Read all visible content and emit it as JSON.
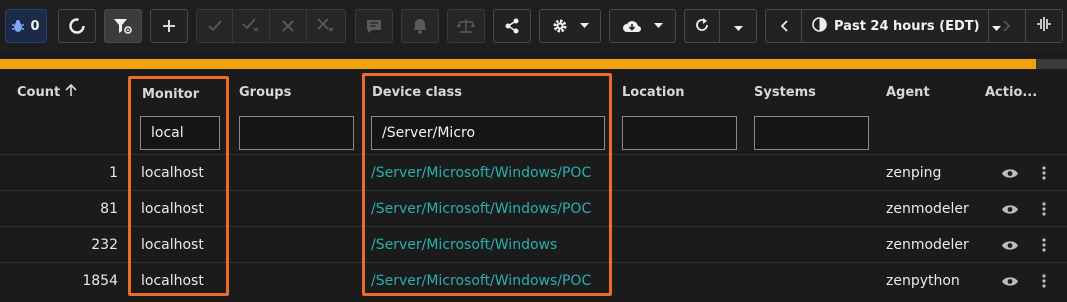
{
  "toolbar": {
    "bug_count": "0",
    "time_range": "Past 24 hours (EDT)"
  },
  "table": {
    "columns": {
      "count": "Count",
      "monitor": "Monitor",
      "groups": "Groups",
      "device_class": "Device class",
      "location": "Location",
      "systems": "Systems",
      "agent": "Agent",
      "actions": "Actio..."
    },
    "filters": {
      "monitor": "local",
      "groups": "",
      "device_class": "/Server/Micro",
      "location": "",
      "systems": ""
    },
    "rows": [
      {
        "count": "1",
        "monitor": "localhost",
        "groups": "",
        "device_class": "/Server/Microsoft/Windows/POC",
        "location": "",
        "systems": "",
        "agent": "zenping"
      },
      {
        "count": "81",
        "monitor": "localhost",
        "groups": "",
        "device_class": "/Server/Microsoft/Windows/POC",
        "location": "",
        "systems": "",
        "agent": "zenmodeler"
      },
      {
        "count": "232",
        "monitor": "localhost",
        "groups": "",
        "device_class": "/Server/Microsoft/Windows",
        "location": "",
        "systems": "",
        "agent": "zenmodeler"
      },
      {
        "count": "1854",
        "monitor": "localhost",
        "groups": "",
        "device_class": "/Server/Microsoft/Windows/POC",
        "location": "",
        "systems": "",
        "agent": "zenpython"
      }
    ]
  },
  "colors": {
    "accent": "#f2a20e",
    "link": "#27b0b0",
    "highlight": "#ec6a2c",
    "background": "#1b1b1b"
  },
  "icons": [
    "bug-icon",
    "refresh-circle-icon",
    "filter-settings-icon",
    "plus-icon",
    "check-icon",
    "check-multiple-icon",
    "close-icon",
    "close-multiple-icon",
    "comment-icon",
    "bell-icon",
    "scale-icon",
    "share-icon",
    "gear-icon",
    "cloud-download-icon",
    "refresh-icon",
    "chevron-down-icon",
    "chevron-left-icon",
    "clock-icon",
    "chevron-right-icon",
    "column-adjust-icon",
    "arrow-up-icon",
    "eye-icon",
    "kebab-icon"
  ]
}
